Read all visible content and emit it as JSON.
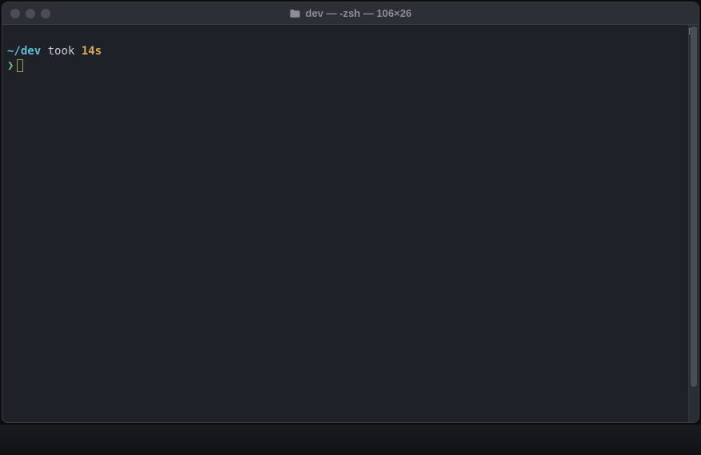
{
  "window": {
    "title": "dev — -zsh — 106×26"
  },
  "prompt": {
    "path_prefix": "~/",
    "directory": "dev",
    "took_label": "took",
    "duration": "14s",
    "symbol": "❯"
  },
  "colors": {
    "background": "#1e2127",
    "titlebar": "#2c2f36",
    "path": "#5fbcd3",
    "duration": "#d6ad5c",
    "prompt_symbol": "#6fbf6f"
  }
}
